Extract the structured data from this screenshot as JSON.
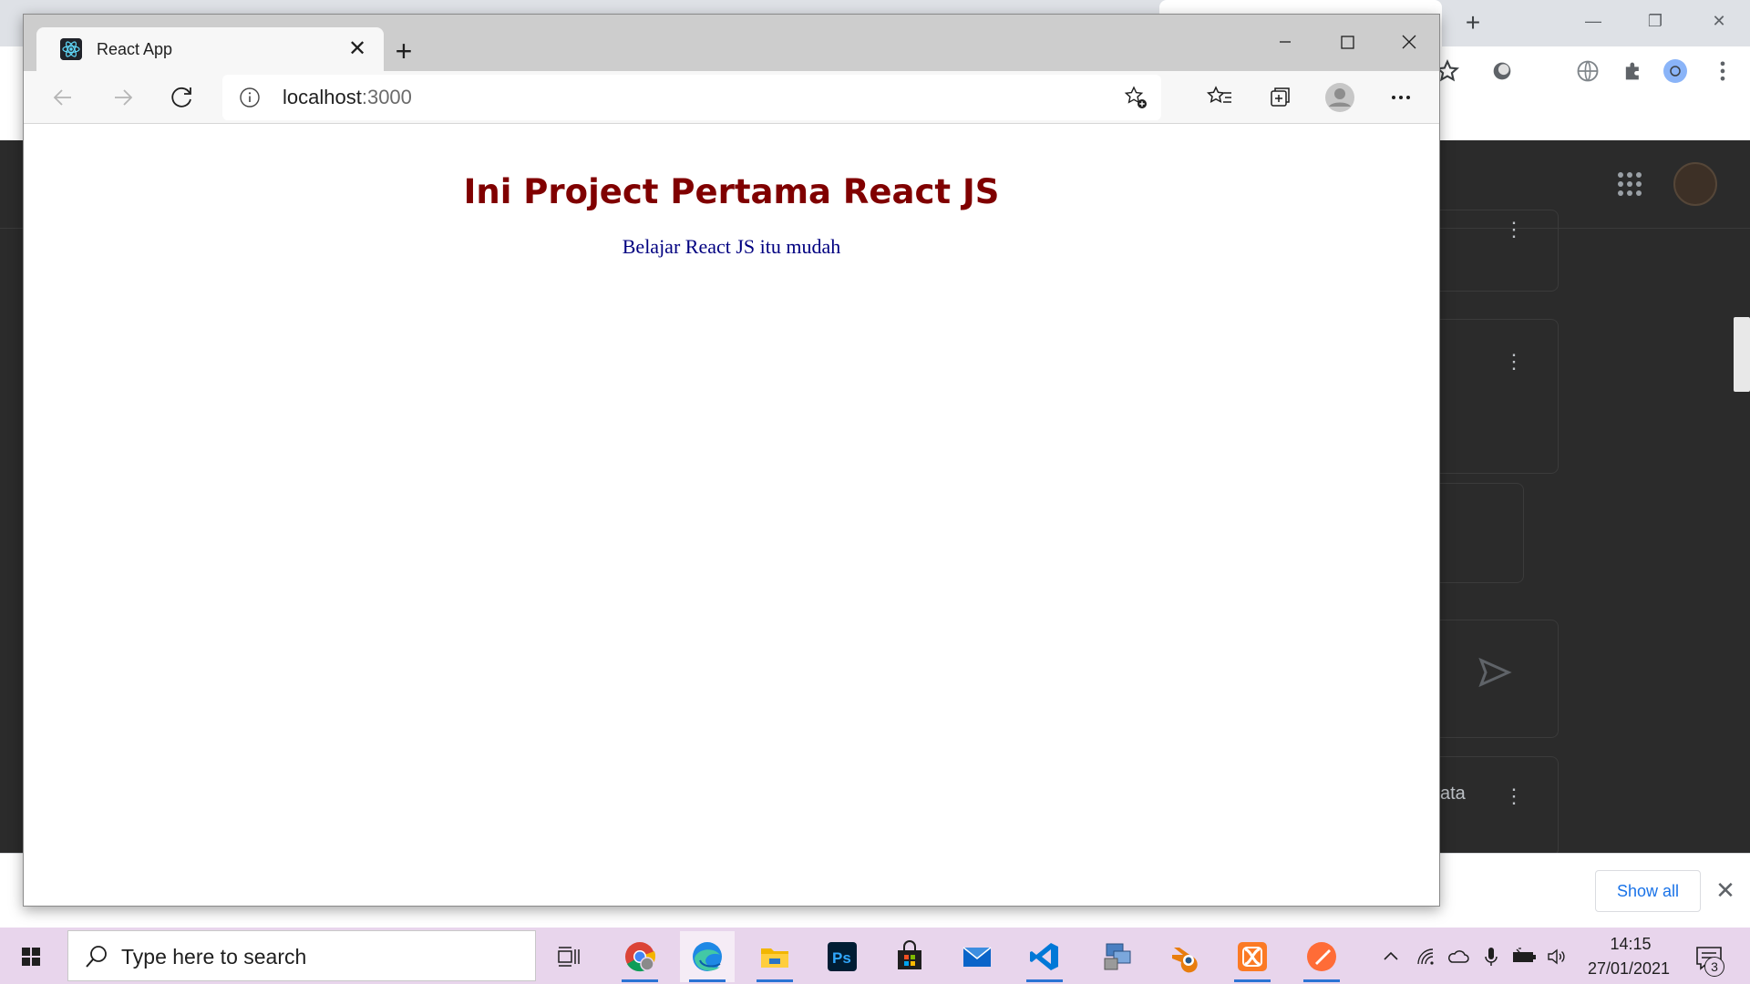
{
  "edge": {
    "tab_title": "React App",
    "address_host": "localhost",
    "address_port": ":3000"
  },
  "page": {
    "heading": "Ini Project Pertama React JS",
    "paragraph": "Belajar React JS itu mudah"
  },
  "download_shelf": {
    "show_all_label": "Show all"
  },
  "background_chrome": {
    "partial_text": "ata"
  },
  "taskbar": {
    "search_placeholder": "Type here to search",
    "clock_time": "14:15",
    "clock_date": "27/01/2021",
    "notification_count": "3",
    "pinned_apps": [
      "chrome-icon",
      "edge-icon",
      "file-explorer-icon",
      "photoshop-icon",
      "microsoft-store-icon",
      "mail-icon",
      "vscode-icon",
      "network-tool-icon",
      "blender-icon",
      "xampp-icon",
      "postman-icon"
    ]
  },
  "colors": {
    "heading": "#800000",
    "paragraph": "#000080",
    "accent_blue": "#1a73e8",
    "taskbar_bg": "#e8d5ec"
  }
}
